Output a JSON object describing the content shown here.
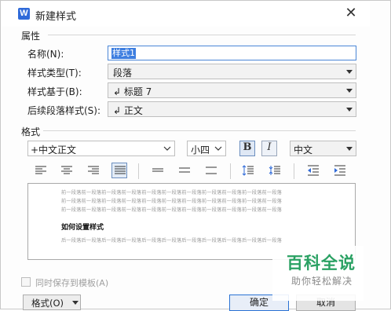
{
  "window": {
    "title": "新建样式",
    "icon_letter": "W"
  },
  "properties": {
    "section_label": "属性",
    "name_label": "名称(N):",
    "name_value": "样式1",
    "style_type_label": "样式类型(T):",
    "style_type_value": "段落",
    "based_on_label": "样式基于(B):",
    "based_on_value": "↲ 标题 7",
    "next_style_label": "后续段落样式(S):",
    "next_style_value": "↲ 正文"
  },
  "format": {
    "section_label": "格式",
    "font_value": "+中文正文",
    "size_value": "小四",
    "bold_label": "B",
    "italic_label": "I",
    "language_value": "中文"
  },
  "preview": {
    "prev_lines": [
      "前一段落前一段落前一段落前一段落前一段落前一段落前一段落前一段落前一段落前一段落前一段落",
      "前一段落前一段落前一段落前一段落前一段落前一段落前一段落前一段落前一段落前一段落前一段落",
      "前一段落前一段落前一段落前一段落前一段落前一段落前一段落前一段落前一段落前一段落前一段落"
    ],
    "sample_text": "如何设置样式",
    "next_lines": [
      "后一段落后一段落后一段落后一段落后一段落后一段落后一段落后一段落后一段落后一段落后一段落"
    ]
  },
  "footer": {
    "template_checkbox_label": "同时保存到模板(A)",
    "format_menu_label": "格式(O)",
    "ok_label": "确定",
    "cancel_label": "取消"
  },
  "watermark": {
    "main": "百科全说",
    "sub": "助你轻松解决"
  },
  "colors": {
    "accent": "#2f6ad9",
    "selection": "#3d7ee0",
    "watermark": "#2aa163"
  }
}
